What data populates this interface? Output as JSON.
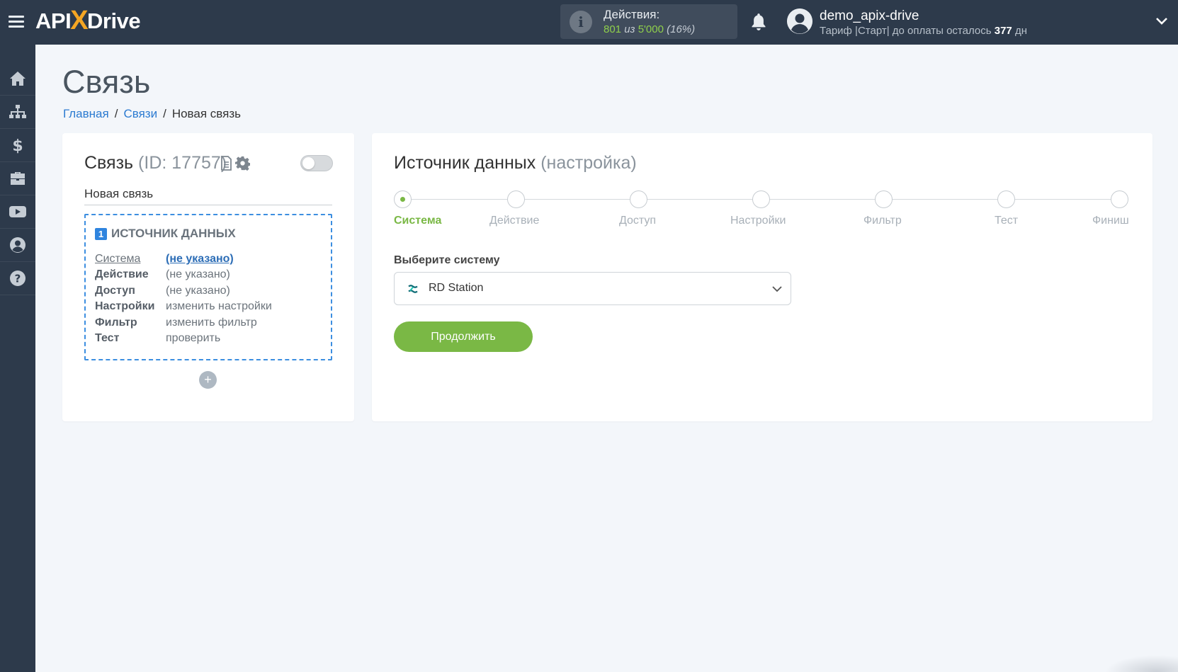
{
  "header": {
    "logo_left": "API",
    "logo_x": "X",
    "logo_right": "Drive",
    "actions_title": "Действия:",
    "actions_used": "801",
    "actions_of": "из",
    "actions_limit": "5'000",
    "actions_percent": "(16%)",
    "user_name": "demo_apix-drive",
    "plan_prefix": "Тариф |Старт| до оплаты осталось",
    "plan_days": "377",
    "plan_suffix": "дн"
  },
  "sidebar": {
    "items": [
      {
        "icon": "home-icon"
      },
      {
        "icon": "sitemap-icon"
      },
      {
        "icon": "dollar-icon"
      },
      {
        "icon": "briefcase-icon"
      },
      {
        "icon": "youtube-icon"
      },
      {
        "icon": "user-circle-icon"
      },
      {
        "icon": "help-icon"
      }
    ]
  },
  "page": {
    "title": "Связь",
    "breadcrumb": {
      "home": "Главная",
      "sep1": "/",
      "connections": "Связи",
      "sep2": "/",
      "current": "Новая связь"
    }
  },
  "connection": {
    "title": "Связь",
    "id_label": "(ID: 17757)",
    "name": "Новая связь",
    "enabled": false,
    "source": {
      "number": "1",
      "heading": "ИСТОЧНИК ДАННЫХ",
      "rows": [
        {
          "label": "Система",
          "value": "(не указано)"
        },
        {
          "label": "Действие",
          "value": "(не указано)"
        },
        {
          "label": "Доступ",
          "value": "(не указано)"
        },
        {
          "label": "Настройки",
          "value": "изменить настройки"
        },
        {
          "label": "Фильтр",
          "value": "изменить фильтр"
        },
        {
          "label": "Тест",
          "value": "проверить"
        }
      ]
    },
    "add_label": "+"
  },
  "source_setup": {
    "title": "Источник данных",
    "subtitle": "(настройка)",
    "steps": [
      "Система",
      "Действие",
      "Доступ",
      "Настройки",
      "Фильтр",
      "Тест",
      "Финиш"
    ],
    "active_step": 0,
    "select_label": "Выберите систему",
    "selected_system": "RD Station",
    "continue_label": "Продолжить"
  },
  "colors": {
    "topbar": "#2d3a4b",
    "accent_green": "#7ab845",
    "link_blue": "#2c7bd1",
    "dashed_border": "#3c8ee0"
  }
}
